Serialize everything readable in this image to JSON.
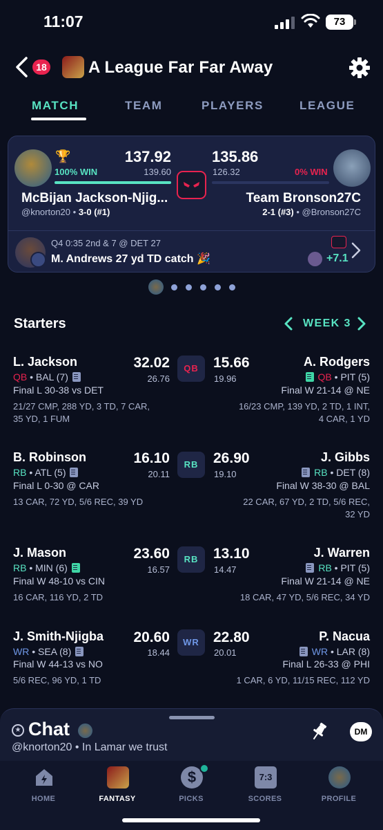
{
  "status_bar": {
    "time": "11:07",
    "battery": "73"
  },
  "header": {
    "notification_count": "18",
    "league_title": "A League Far Far Away"
  },
  "tabs": [
    {
      "label": "MATCH",
      "active": true
    },
    {
      "label": "TEAM",
      "active": false
    },
    {
      "label": "PLAYERS",
      "active": false
    },
    {
      "label": "LEAGUE",
      "active": false
    }
  ],
  "matchup": {
    "left": {
      "win_pct": "100% WIN",
      "score": "137.92",
      "projected": "139.60",
      "name": "McBijan Jackson-Njig...",
      "handle": "@knorton20",
      "record": "3-0 (#1)",
      "win_fraction": 1.0
    },
    "right": {
      "win_pct": "0% WIN",
      "score": "135.86",
      "projected": "126.32",
      "name": "Team Bronson27C",
      "handle": "@Bronson27C",
      "record": "2-1 (#3)",
      "win_fraction": 0.0
    },
    "live_play": {
      "clock": "Q4 0:35 2nd & 7 @ DET 27",
      "description": "M. Andrews 27 yd TD catch 🎉",
      "delta": "+7.1"
    }
  },
  "pager": {
    "dots": 5
  },
  "starters": {
    "title": "Starters",
    "week": "WEEK 3",
    "rows": [
      {
        "position": "QB",
        "pos_color": "#e8234f",
        "left": {
          "name": "L. Jackson",
          "pos": "QB",
          "team": "• BAL (7)",
          "status": "Final L 30-38 vs DET",
          "stats1": "21/27 CMP, 288 YD, 3 TD, 7 CAR,",
          "stats2": "35 YD, 1 FUM",
          "points": "32.02",
          "projected": "26.76"
        },
        "right": {
          "name": "A. Rodgers",
          "pos": "QB",
          "team": "• PIT (5)",
          "status": "Final W 21-14 @ NE",
          "stats1": "16/23 CMP, 139 YD, 2 TD, 1 INT,",
          "stats2": "4 CAR, 1 YD",
          "points": "15.66",
          "projected": "19.96"
        }
      },
      {
        "position": "RB",
        "pos_color": "#58e3c2",
        "left": {
          "name": "B. Robinson",
          "pos": "RB",
          "team": "• ATL (5)",
          "status": "Final L 0-30 @ CAR",
          "stats1": "13 CAR, 72 YD, 5/6 REC, 39 YD",
          "stats2": "",
          "points": "16.10",
          "projected": "20.11"
        },
        "right": {
          "name": "J. Gibbs",
          "pos": "RB",
          "team": "• DET (8)",
          "status": "Final W 38-30 @ BAL",
          "stats1": "22 CAR, 67 YD, 2 TD, 5/6 REC,",
          "stats2": "32 YD",
          "points": "26.90",
          "projected": "19.10"
        }
      },
      {
        "position": "RB",
        "pos_color": "#58e3c2",
        "left": {
          "name": "J. Mason",
          "pos": "RB",
          "team": "• MIN (6)",
          "status": "Final W 48-10 vs CIN",
          "stats1": "16 CAR, 116 YD, 2 TD",
          "stats2": "",
          "points": "23.60",
          "projected": "16.57"
        },
        "right": {
          "name": "J. Warren",
          "pos": "RB",
          "team": "• PIT (5)",
          "status": "Final W 21-14 @ NE",
          "stats1": "18 CAR, 47 YD, 5/6 REC, 34 YD",
          "stats2": "",
          "points": "13.10",
          "projected": "14.47"
        }
      },
      {
        "position": "WR",
        "pos_color": "#6f97e6",
        "left": {
          "name": "J. Smith-Njigba",
          "pos": "WR",
          "team": "• SEA (8)",
          "status": "Final W 44-13 vs NO",
          "stats1": "5/6 REC, 96 YD, 1 TD",
          "stats2": "",
          "points": "20.60",
          "projected": "18.44"
        },
        "right": {
          "name": "P. Nacua",
          "pos": "WR",
          "team": "• LAR (8)",
          "status": "Final L 26-33 @ PHI",
          "stats1": "1 CAR, 6 YD, 11/15 REC, 112 YD",
          "stats2": "",
          "points": "22.80",
          "projected": "20.01"
        }
      }
    ]
  },
  "chat": {
    "title": "Chat",
    "last_message": "@knorton20 • In Lamar we trust",
    "dm_label": "DM"
  },
  "bottom_nav": [
    {
      "label": "HOME",
      "icon": "home-icon",
      "active": false
    },
    {
      "label": "FANTASY",
      "icon": "fantasy-avatar-icon",
      "active": true
    },
    {
      "label": "PICKS",
      "icon": "dollar-icon",
      "active": false
    },
    {
      "label": "SCORES",
      "icon": "scoreboard-icon",
      "active": false
    },
    {
      "label": "PROFILE",
      "icon": "profile-avatar-icon",
      "active": false
    }
  ],
  "colors": {
    "accent": "#58e3c2",
    "alert": "#e8234f",
    "background": "#0b0f1d",
    "card": "#1a2140"
  }
}
